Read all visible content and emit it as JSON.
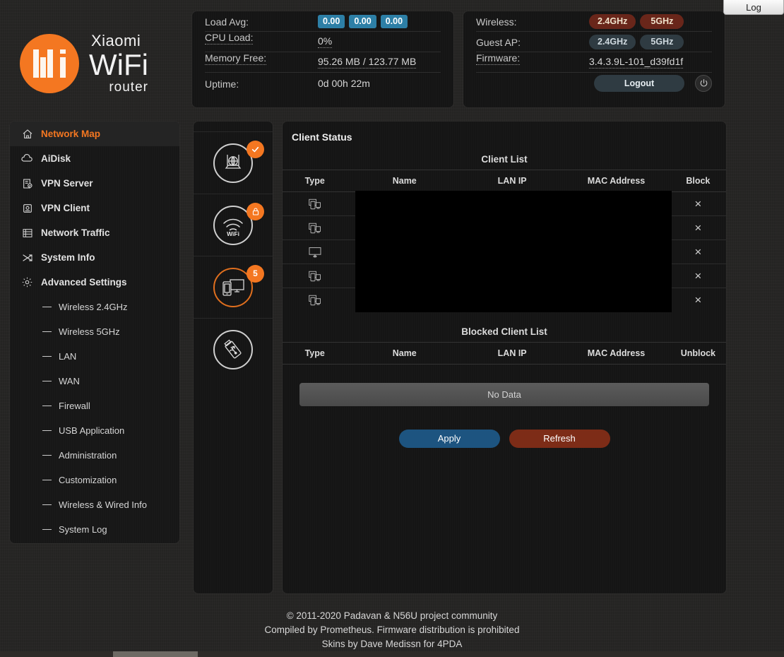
{
  "log_tab": {
    "label": "Log"
  },
  "brand": {
    "line1": "Xiaomi",
    "line2": "WiFi",
    "line3": "router",
    "accent": "#f47721"
  },
  "status_left": {
    "rows": [
      {
        "label": "Load Avg:",
        "chips": [
          "0.00",
          "0.00",
          "0.00"
        ]
      },
      {
        "label": "CPU Load:",
        "value": "0%"
      },
      {
        "label": "Memory Free:",
        "value": "95.26 MB / 123.77 MB"
      },
      {
        "label": "Uptime:",
        "value": "0d 00h 22m"
      }
    ]
  },
  "status_right": {
    "wireless_label": "Wireless:",
    "wireless_bands": [
      "2.4GHz",
      "5GHz"
    ],
    "guest_label": "Guest AP:",
    "guest_bands": [
      "2.4GHz",
      "5GHz"
    ],
    "firmware_label": "Firmware:",
    "firmware_value": "3.4.3.9L-101_d39fd1f",
    "logout_label": "Logout",
    "power_icon": "power-icon",
    "active_color": "#69261a",
    "inactive_color": "#2f3b42"
  },
  "sidebar": {
    "items": [
      {
        "label": "Network Map",
        "icon": "home-icon",
        "active": true
      },
      {
        "label": "AiDisk",
        "icon": "cloud-icon",
        "active": false
      },
      {
        "label": "VPN Server",
        "icon": "vpn-server-icon",
        "active": false
      },
      {
        "label": "VPN Client",
        "icon": "vpn-client-icon",
        "active": false
      },
      {
        "label": "Network Traffic",
        "icon": "traffic-list-icon",
        "active": false
      },
      {
        "label": "System Info",
        "icon": "shuffle-icon",
        "active": false
      },
      {
        "label": "Advanced Settings",
        "icon": "gear-icon",
        "active": false
      }
    ],
    "sub_items": [
      {
        "label": "Wireless 2.4GHz"
      },
      {
        "label": "Wireless 5GHz"
      },
      {
        "label": "LAN"
      },
      {
        "label": "WAN"
      },
      {
        "label": "Firewall"
      },
      {
        "label": "USB Application"
      },
      {
        "label": "Administration"
      },
      {
        "label": "Customization"
      },
      {
        "label": "Wireless & Wired Info"
      },
      {
        "label": "System Log"
      }
    ]
  },
  "icon_column": {
    "items": [
      {
        "icon": "internet-globe-icon",
        "badge": "check",
        "badge_text": "",
        "selected": false
      },
      {
        "icon": "wifi-icon",
        "badge": "lock",
        "badge_text": "",
        "selected": false
      },
      {
        "icon": "clients-devices-icon",
        "badge": "count",
        "badge_text": "5",
        "selected": true
      },
      {
        "icon": "usb-device-icon",
        "badge": "none",
        "badge_text": "",
        "selected": false
      }
    ]
  },
  "main": {
    "title": "Client Status",
    "client_list": {
      "section_title": "Client List",
      "headers": [
        "Type",
        "Name",
        "LAN IP",
        "MAC Address",
        "Block"
      ],
      "rows": [
        {
          "type_icon": "device-mobile-desktop-icon",
          "name": "",
          "lan_ip": "",
          "mac": "",
          "action": "×"
        },
        {
          "type_icon": "device-mobile-desktop-icon",
          "name": "",
          "lan_ip": "",
          "mac": "",
          "action": "×"
        },
        {
          "type_icon": "desktop-monitor-icon",
          "name": "",
          "lan_ip": "",
          "mac": "",
          "action": "×"
        },
        {
          "type_icon": "device-mobile-desktop-icon",
          "name": "",
          "lan_ip": "",
          "mac": "",
          "action": "×"
        },
        {
          "type_icon": "device-mobile-desktop-icon",
          "name": "",
          "lan_ip": "",
          "mac": "",
          "action": "×"
        }
      ],
      "redacted": true
    },
    "blocked_list": {
      "section_title": "Blocked Client List",
      "headers": [
        "Type",
        "Name",
        "LAN IP",
        "MAC Address",
        "Unblock"
      ],
      "empty_text": "No Data"
    },
    "buttons": {
      "apply": "Apply",
      "refresh": "Refresh",
      "apply_color": "#1d5480",
      "refresh_color": "#7d2c17"
    }
  },
  "footer": {
    "line1": "© 2011-2020 Padavan & N56U project community",
    "line2": "Compiled by Prometheus. Firmware distribution is prohibited",
    "line3": "Skins by Dave Medissn for 4PDA"
  }
}
